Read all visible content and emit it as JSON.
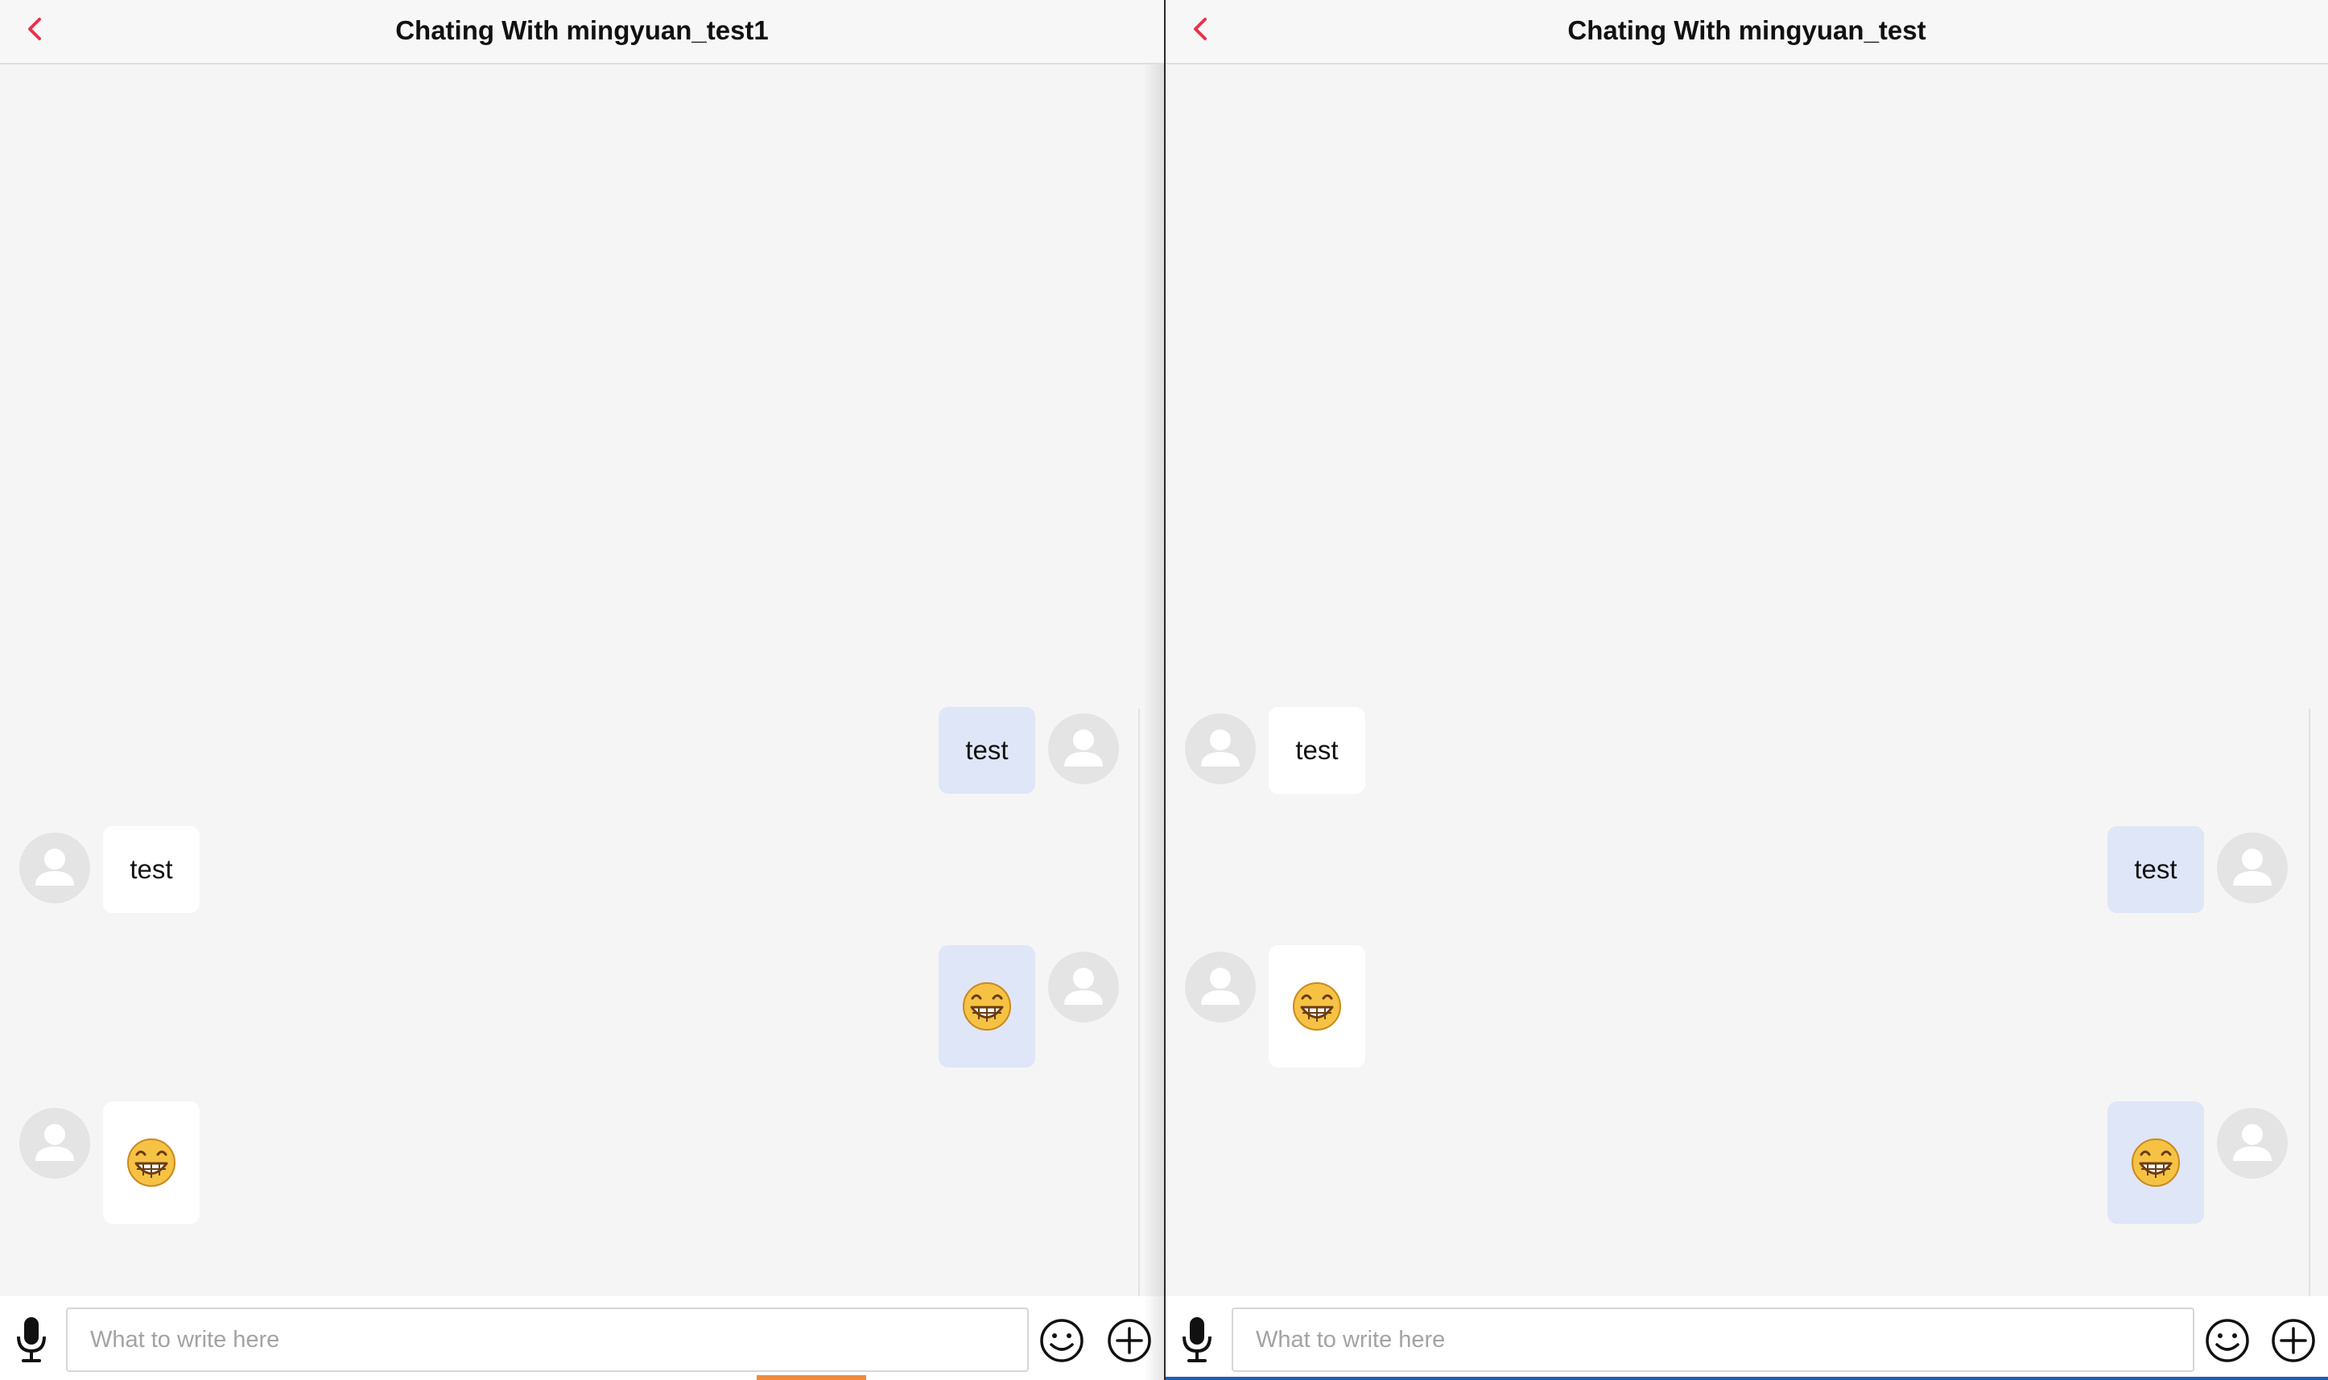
{
  "left_pane": {
    "header": {
      "title": "Chating With mingyuan_test1",
      "back_icon": "chevron-left-icon"
    },
    "messages": [
      {
        "direction": "outgoing",
        "type": "text",
        "text": "test"
      },
      {
        "direction": "incoming",
        "type": "text",
        "text": "test"
      },
      {
        "direction": "outgoing",
        "type": "emoji",
        "emoji": "grinning-face-emoji"
      },
      {
        "direction": "incoming",
        "type": "emoji",
        "emoji": "grinning-face-emoji"
      }
    ],
    "input_bar": {
      "placeholder": "What to write here",
      "value": "",
      "icons": [
        "microphone-icon",
        "smiley-icon",
        "plus-circle-icon"
      ]
    }
  },
  "right_pane": {
    "header": {
      "title": "Chating With mingyuan_test",
      "back_icon": "chevron-left-icon"
    },
    "messages": [
      {
        "direction": "incoming",
        "type": "text",
        "text": "test"
      },
      {
        "direction": "outgoing",
        "type": "text",
        "text": "test"
      },
      {
        "direction": "incoming",
        "type": "emoji",
        "emoji": "grinning-face-emoji"
      },
      {
        "direction": "outgoing",
        "type": "emoji",
        "emoji": "grinning-face-emoji"
      }
    ],
    "input_bar": {
      "placeholder": "What to write here",
      "value": "",
      "icons": [
        "microphone-icon",
        "smiley-icon",
        "plus-circle-icon"
      ]
    }
  },
  "colors": {
    "back_arrow": "#e8334a",
    "outgoing_bubble": "#dfe6f7",
    "incoming_bubble": "#ffffff",
    "chat_background": "#f5f5f5",
    "avatar_background": "#e4e4e4"
  }
}
